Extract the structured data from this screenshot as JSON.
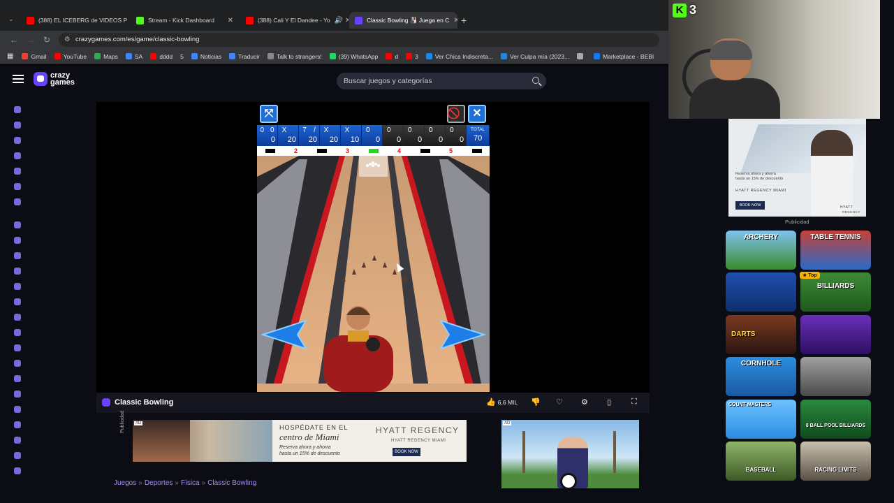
{
  "browser": {
    "tabs": [
      {
        "label": "(388) EL ICEBERG de VIDEOS P",
        "favicon": "#ff0000",
        "active": false
      },
      {
        "label": "Stream - Kick Dashboard",
        "favicon": "#53fc18",
        "active": false
      },
      {
        "label": "(388) Cali Y El Dandee - Yo",
        "favicon": "#ff0000",
        "active": false
      },
      {
        "label": "Classic Bowling 🎳 Juega en C",
        "favicon": "#6842ff",
        "active": true
      }
    ],
    "new_tab": "+",
    "url": "crazygames.com/es/game/classic-bowling",
    "bookmarks": [
      {
        "label": "Gmail",
        "color": "#ea4335"
      },
      {
        "label": "YouTube",
        "color": "#ff0000"
      },
      {
        "label": "Maps",
        "color": "#34a853"
      },
      {
        "label": "SA",
        "color": "#4285f4"
      },
      {
        "label": "dddd",
        "color": "#ff0000"
      },
      {
        "label": "5",
        "color": "#35363a"
      },
      {
        "label": "Noticias",
        "color": "#4285f4"
      },
      {
        "label": "Traducir",
        "color": "#4285f4"
      },
      {
        "label": "Talk to strangers!",
        "color": "#888888"
      },
      {
        "label": "(39) WhatsApp",
        "color": "#25d366"
      },
      {
        "label": "d",
        "color": "#ff0000"
      },
      {
        "label": "3",
        "color": "#ff0000"
      },
      {
        "label": "Ver Chica Indiscreta...",
        "color": "#1e88e5"
      },
      {
        "label": "Ver Culpa mía (2023...",
        "color": "#1e88e5"
      },
      {
        "label": "",
        "color": "#aaaaaa"
      },
      {
        "label": "Marketplace - BEBI",
        "color": "#1877f2"
      }
    ]
  },
  "site": {
    "logo_top": "crazy",
    "logo_bottom": "games",
    "search_placeholder": "Buscar juegos y categorías"
  },
  "game": {
    "title": "Classic Bowling",
    "likes": "6,6 MIL",
    "scoreboard": [
      {
        "r1": "0",
        "r2": "0",
        "total": "0"
      },
      {
        "r1": "X",
        "r2": "",
        "total": "20"
      },
      {
        "r1": "7",
        "r2": "/",
        "total": "20"
      },
      {
        "r1": "X",
        "r2": "",
        "total": "20"
      },
      {
        "r1": "X",
        "r2": "",
        "total": "10"
      },
      {
        "r1": "0",
        "r2": "",
        "total": "0"
      },
      {
        "r1": "0",
        "r2": "",
        "total": "0"
      },
      {
        "r1": "0",
        "r2": "",
        "total": "0"
      },
      {
        "r1": "0",
        "r2": "",
        "total": "0"
      },
      {
        "r1": "0",
        "r2": "",
        "total": "0"
      }
    ],
    "total_label": "TOTAL",
    "total_value": "70",
    "frame_markers": [
      "",
      "2",
      "",
      "3",
      "",
      "4",
      "",
      "5",
      ""
    ],
    "active_frame_pip": 4
  },
  "ads": {
    "ad_label": "AD",
    "banner_head": "HOSPÉDATE EN EL",
    "banner_sub": "centro de Miami",
    "banner_offer1": "Reserva ahora y ahorra",
    "banner_offer2": "hasta un 15% de descuento",
    "banner_brand": "HYATT REGENCY",
    "banner_brandsub": "HYATT REGENCY MIAMI",
    "banner_book": "BOOK NOW",
    "banner_publicidad": "Publicidad",
    "side_line1": "Reserva ahora y ahorra",
    "side_line2": "hasta un 15% de descuento",
    "side_brand": "HYATT REGENCY MIAMI",
    "side_book": "BOOK NOW",
    "side_hy1": "HYATT",
    "side_hy2": "REGENCY",
    "publicidad": "Publicidad"
  },
  "breadcrumb": [
    "Juegos",
    "Deportes",
    "Física",
    "Classic Bowling"
  ],
  "sidebar_games": [
    {
      "title": "ARCHERY",
      "bg": "#3a8a2a"
    },
    {
      "title": "TABLE TENNIS",
      "bg": "#c44236"
    },
    {
      "title": "",
      "bg": "#1e4fae"
    },
    {
      "title": "BILLIARDS",
      "bg": "#2f6d2b"
    },
    {
      "title": "DARTS",
      "bg": "#5a3020"
    },
    {
      "title": "",
      "bg": "#4b1f8a"
    },
    {
      "title": "CORNHOLE",
      "bg": "#1f7cc8"
    },
    {
      "title": "",
      "bg": "#7a7a7a"
    },
    {
      "title": "COUNT MASTERS",
      "bg": "#2b8de0"
    },
    {
      "title": "8 BALL POOL BILLIARDS",
      "bg": "#1e6a2e"
    },
    {
      "title": "BASEBALL",
      "bg": "#5a7a3a"
    },
    {
      "title": "RACING LIMITS",
      "bg": "#9a8d78"
    }
  ],
  "top_badge": "Top",
  "kick": {
    "letter": "K",
    "count": "3"
  }
}
